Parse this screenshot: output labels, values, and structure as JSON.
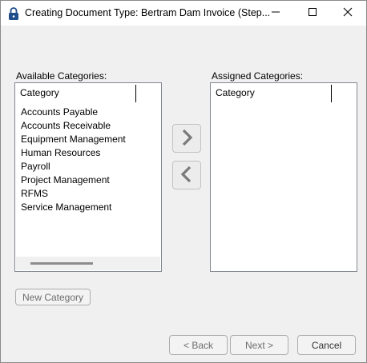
{
  "window": {
    "title": "Creating Document Type: Bertram Dam Invoice (Step...",
    "controls": {
      "minimize_icon": "minimize-icon",
      "maximize_icon": "maximize-icon",
      "close_icon": "close-icon"
    },
    "app_icon": "lock-icon"
  },
  "available": {
    "label": "Available Categories:",
    "column_header": "Category",
    "items": [
      "Accounts Payable",
      "Accounts Receivable",
      "Equipment Management",
      "Human Resources",
      "Payroll",
      "Project Management",
      "RFMS",
      "Service Management"
    ]
  },
  "assigned": {
    "label": "Assigned Categories:",
    "column_header": "Category",
    "items": []
  },
  "transfer": {
    "add_icon": "chevron-right-icon",
    "remove_icon": "chevron-left-icon"
  },
  "buttons": {
    "new_category": "New Category",
    "back": "< Back",
    "next": "Next >",
    "cancel": "Cancel"
  },
  "colors": {
    "window_bg": "#f0f0f0",
    "titlebar_bg": "#ffffff",
    "disabled_text": "#6d6d6d",
    "icon_blue": "#1f4e8c"
  }
}
